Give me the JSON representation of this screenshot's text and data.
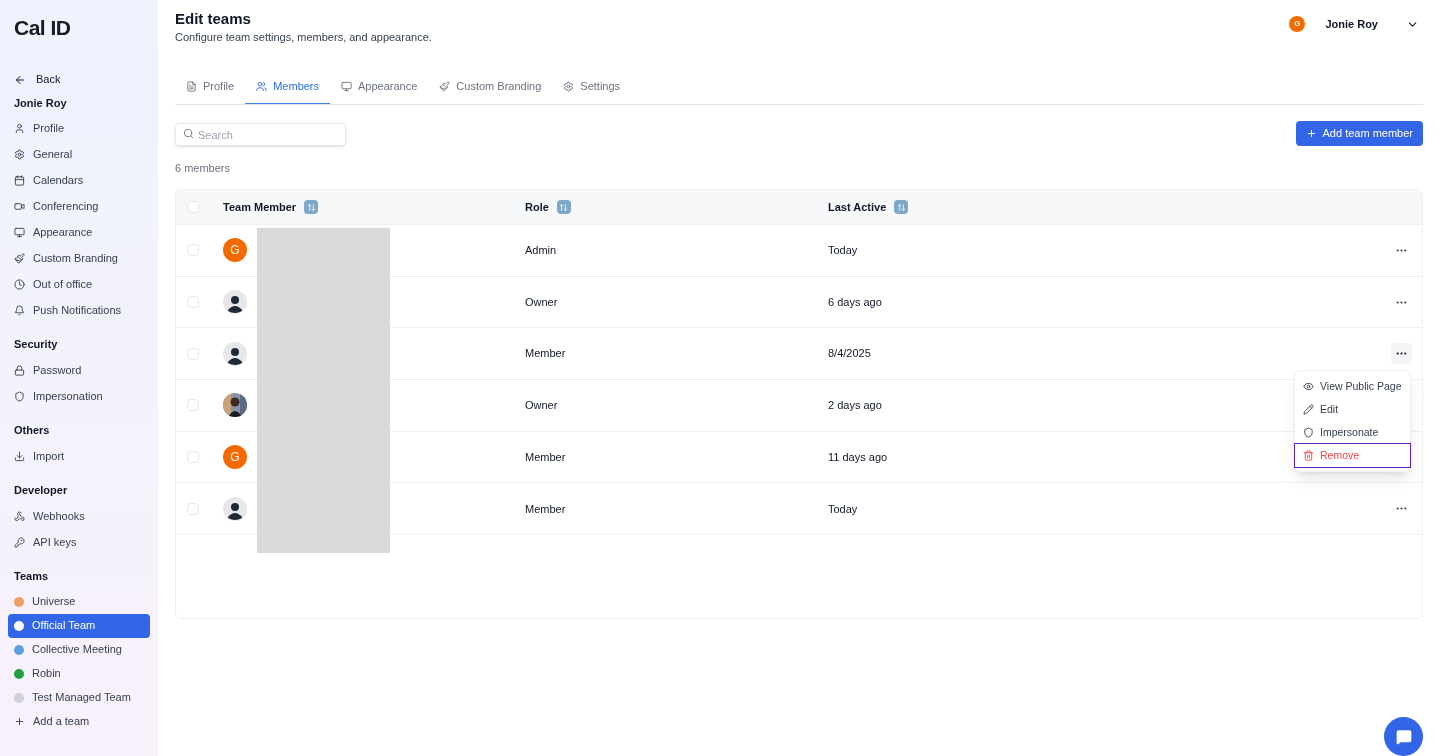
{
  "logo": "Cal ID",
  "sidebar": {
    "back": "Back",
    "user": "Jonie Roy",
    "sections": [
      {
        "items": [
          "Profile",
          "General",
          "Calendars",
          "Conferencing",
          "Appearance",
          "Custom Branding",
          "Out of office",
          "Push Notifications"
        ]
      },
      {
        "title": "Security",
        "items": [
          "Password",
          "Impersonation"
        ]
      },
      {
        "title": "Others",
        "items": [
          "Import"
        ]
      },
      {
        "title": "Developer",
        "items": [
          "Webhooks",
          "API keys"
        ]
      }
    ],
    "teams_title": "Teams",
    "teams": [
      {
        "name": "Universe",
        "selected": false,
        "color": "#f0a060"
      },
      {
        "name": "Official Team",
        "selected": true,
        "color": "#ffffff"
      },
      {
        "name": "Collective Meeting",
        "selected": false,
        "color": "#5aa0e0"
      },
      {
        "name": "Robin",
        "selected": false,
        "color": "#22a045"
      },
      {
        "name": "Test Managed Team",
        "selected": false,
        "color": "#d0d0d8"
      }
    ],
    "add_team": "Add a team"
  },
  "header": {
    "title": "Edit teams",
    "subtitle": "Configure team settings, members, and appearance.",
    "user_initial": "G",
    "user_name": "Jonie Roy"
  },
  "tabs": [
    {
      "label": "Profile",
      "selected": false
    },
    {
      "label": "Members",
      "selected": true
    },
    {
      "label": "Appearance",
      "selected": false
    },
    {
      "label": "Custom Branding",
      "selected": false
    },
    {
      "label": "Settings",
      "selected": false
    }
  ],
  "search": {
    "placeholder": "Search"
  },
  "add_button": "Add team member",
  "count": "6 members",
  "table": {
    "columns": [
      "Team Member",
      "Role",
      "Last Active"
    ],
    "all_checked": false,
    "rows": [
      {
        "avatar": {
          "kind": "initial",
          "initial": "G"
        },
        "role": "Admin",
        "last_active": "Today",
        "checked": false,
        "menu_open": false
      },
      {
        "avatar": {
          "kind": "silhouette"
        },
        "role": "Owner",
        "last_active": "6 days ago",
        "checked": false,
        "menu_open": false
      },
      {
        "avatar": {
          "kind": "silhouette"
        },
        "role": "Member",
        "last_active": "8/4/2025",
        "checked": false,
        "menu_open": true
      },
      {
        "role": "Owner",
        "last_active": "2 days ago",
        "checked": false
      },
      {
        "avatar": {
          "kind": "initial",
          "initial": "G"
        },
        "role": "Member",
        "last_active": "11 days ago",
        "checked": false
      },
      {
        "avatar": {
          "kind": "silhouette"
        },
        "role": "Member",
        "last_active": "Today",
        "checked": false,
        "menu_open": false
      }
    ]
  },
  "row_menu": {
    "items": [
      {
        "label": "View Public Page",
        "kind": "normal",
        "selected": false
      },
      {
        "label": "Edit",
        "kind": "normal",
        "selected": false
      },
      {
        "label": "Impersonate",
        "kind": "normal",
        "selected": false
      },
      {
        "label": "Remove",
        "kind": "danger",
        "selected": true
      }
    ]
  }
}
